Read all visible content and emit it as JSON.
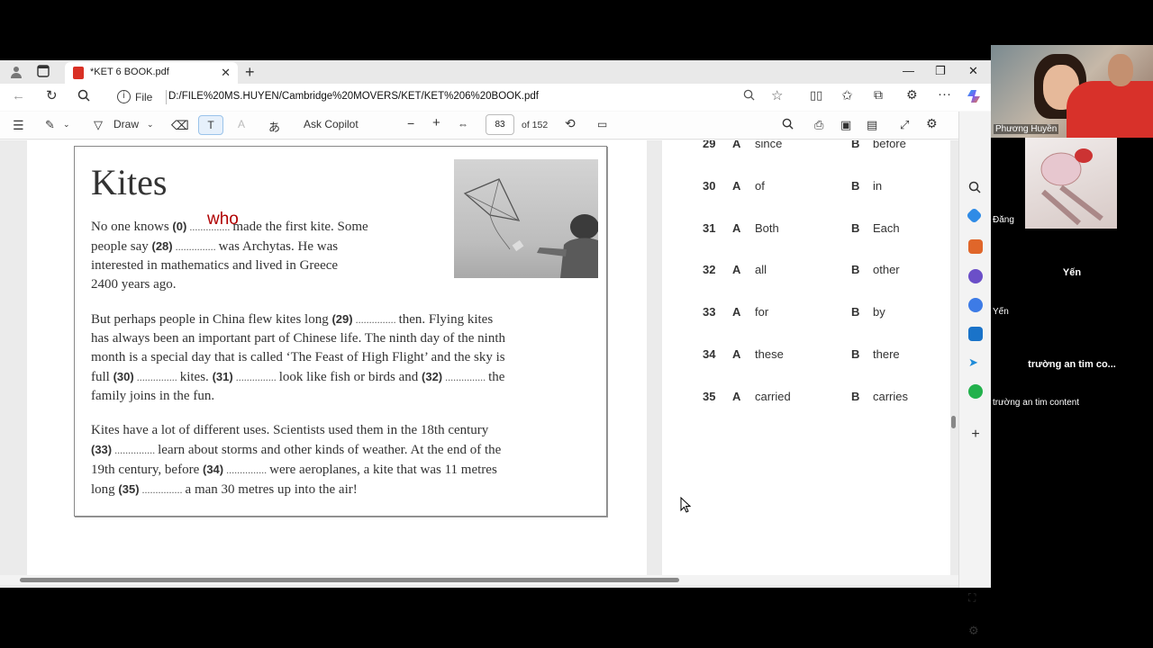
{
  "browser": {
    "tab_title": "*KET 6 BOOK.pdf",
    "address_label": "File",
    "url": "D:/FILE%20MS.HUYEN/Cambridge%20MOVERS/KET/KET%206%20BOOK.pdf"
  },
  "pdf_toolbar": {
    "draw_label": "Draw",
    "copilot_label": "Ask Copilot",
    "page_number": "83",
    "page_total": "of 152"
  },
  "page": {
    "title": "Kites",
    "handwritten_answer": "who",
    "para1": [
      {
        "t": "No one knows "
      },
      {
        "n": "(0)"
      },
      {
        "d": " ............... "
      },
      {
        "t": "made the first kite. Some"
      },
      {
        "br": true
      },
      {
        "t": "people say "
      },
      {
        "n": "(28)"
      },
      {
        "d": " ............... "
      },
      {
        "t": "was Archytas. He was"
      },
      {
        "br": true
      },
      {
        "t": "interested in mathematics and lived in Greece"
      },
      {
        "br": true
      },
      {
        "t": "2400 years ago."
      }
    ],
    "para2": [
      {
        "t": "But perhaps people in China flew kites long "
      },
      {
        "n": "(29)"
      },
      {
        "d": " ............... "
      },
      {
        "t": "then. Flying kites"
      },
      {
        "br": true
      },
      {
        "t": "has always been an important part of Chinese life. The ninth day of the ninth"
      },
      {
        "br": true
      },
      {
        "t": "month is a special day that is called ‘The Feast of High Flight’ and the sky is"
      },
      {
        "br": true
      },
      {
        "t": "full "
      },
      {
        "n": "(30)"
      },
      {
        "d": " ............... "
      },
      {
        "t": "kites. "
      },
      {
        "n": "(31)"
      },
      {
        "d": " ............... "
      },
      {
        "t": "look like fish or birds and "
      },
      {
        "n": "(32)"
      },
      {
        "d": " ............... "
      },
      {
        "t": "the"
      },
      {
        "br": true
      },
      {
        "t": "family joins in the fun."
      }
    ],
    "para3": [
      {
        "t": "Kites have a lot of different uses. Scientists used them in the 18th century"
      },
      {
        "br": true
      },
      {
        "n": "(33)"
      },
      {
        "d": " ............... "
      },
      {
        "t": "learn about storms and other kinds of weather. At the end of the"
      },
      {
        "br": true
      },
      {
        "t": "19th century, before "
      },
      {
        "n": "(34)"
      },
      {
        "d": " ............... "
      },
      {
        "t": "were aeroplanes, a kite that was 11 metres"
      },
      {
        "br": true
      },
      {
        "t": "long "
      },
      {
        "n": "(35)"
      },
      {
        "d": " ............... "
      },
      {
        "t": "a man 30 metres up into the air!"
      }
    ]
  },
  "answers": [
    {
      "num": "29",
      "a": "A",
      "a_val": "since",
      "b": "B",
      "b_val": "before"
    },
    {
      "num": "30",
      "a": "A",
      "a_val": "of",
      "b": "B",
      "b_val": "in"
    },
    {
      "num": "31",
      "a": "A",
      "a_val": "Both",
      "b": "B",
      "b_val": "Each"
    },
    {
      "num": "32",
      "a": "A",
      "a_val": "all",
      "b": "B",
      "b_val": "other"
    },
    {
      "num": "33",
      "a": "A",
      "a_val": "for",
      "b": "B",
      "b_val": "by"
    },
    {
      "num": "34",
      "a": "A",
      "a_val": "these",
      "b": "B",
      "b_val": "there"
    },
    {
      "num": "35",
      "a": "A",
      "a_val": "carried",
      "b": "B",
      "b_val": "carries"
    }
  ],
  "video": {
    "p1": "Phương Huyền",
    "p2": "Đăng",
    "p3_center": "Yến",
    "p3": "Yến",
    "p4_center": "trường an tim co...",
    "p4": "trường an tim content"
  },
  "colors": {
    "accent_answer": "#b00000",
    "pdf_icon": "#d93025"
  }
}
